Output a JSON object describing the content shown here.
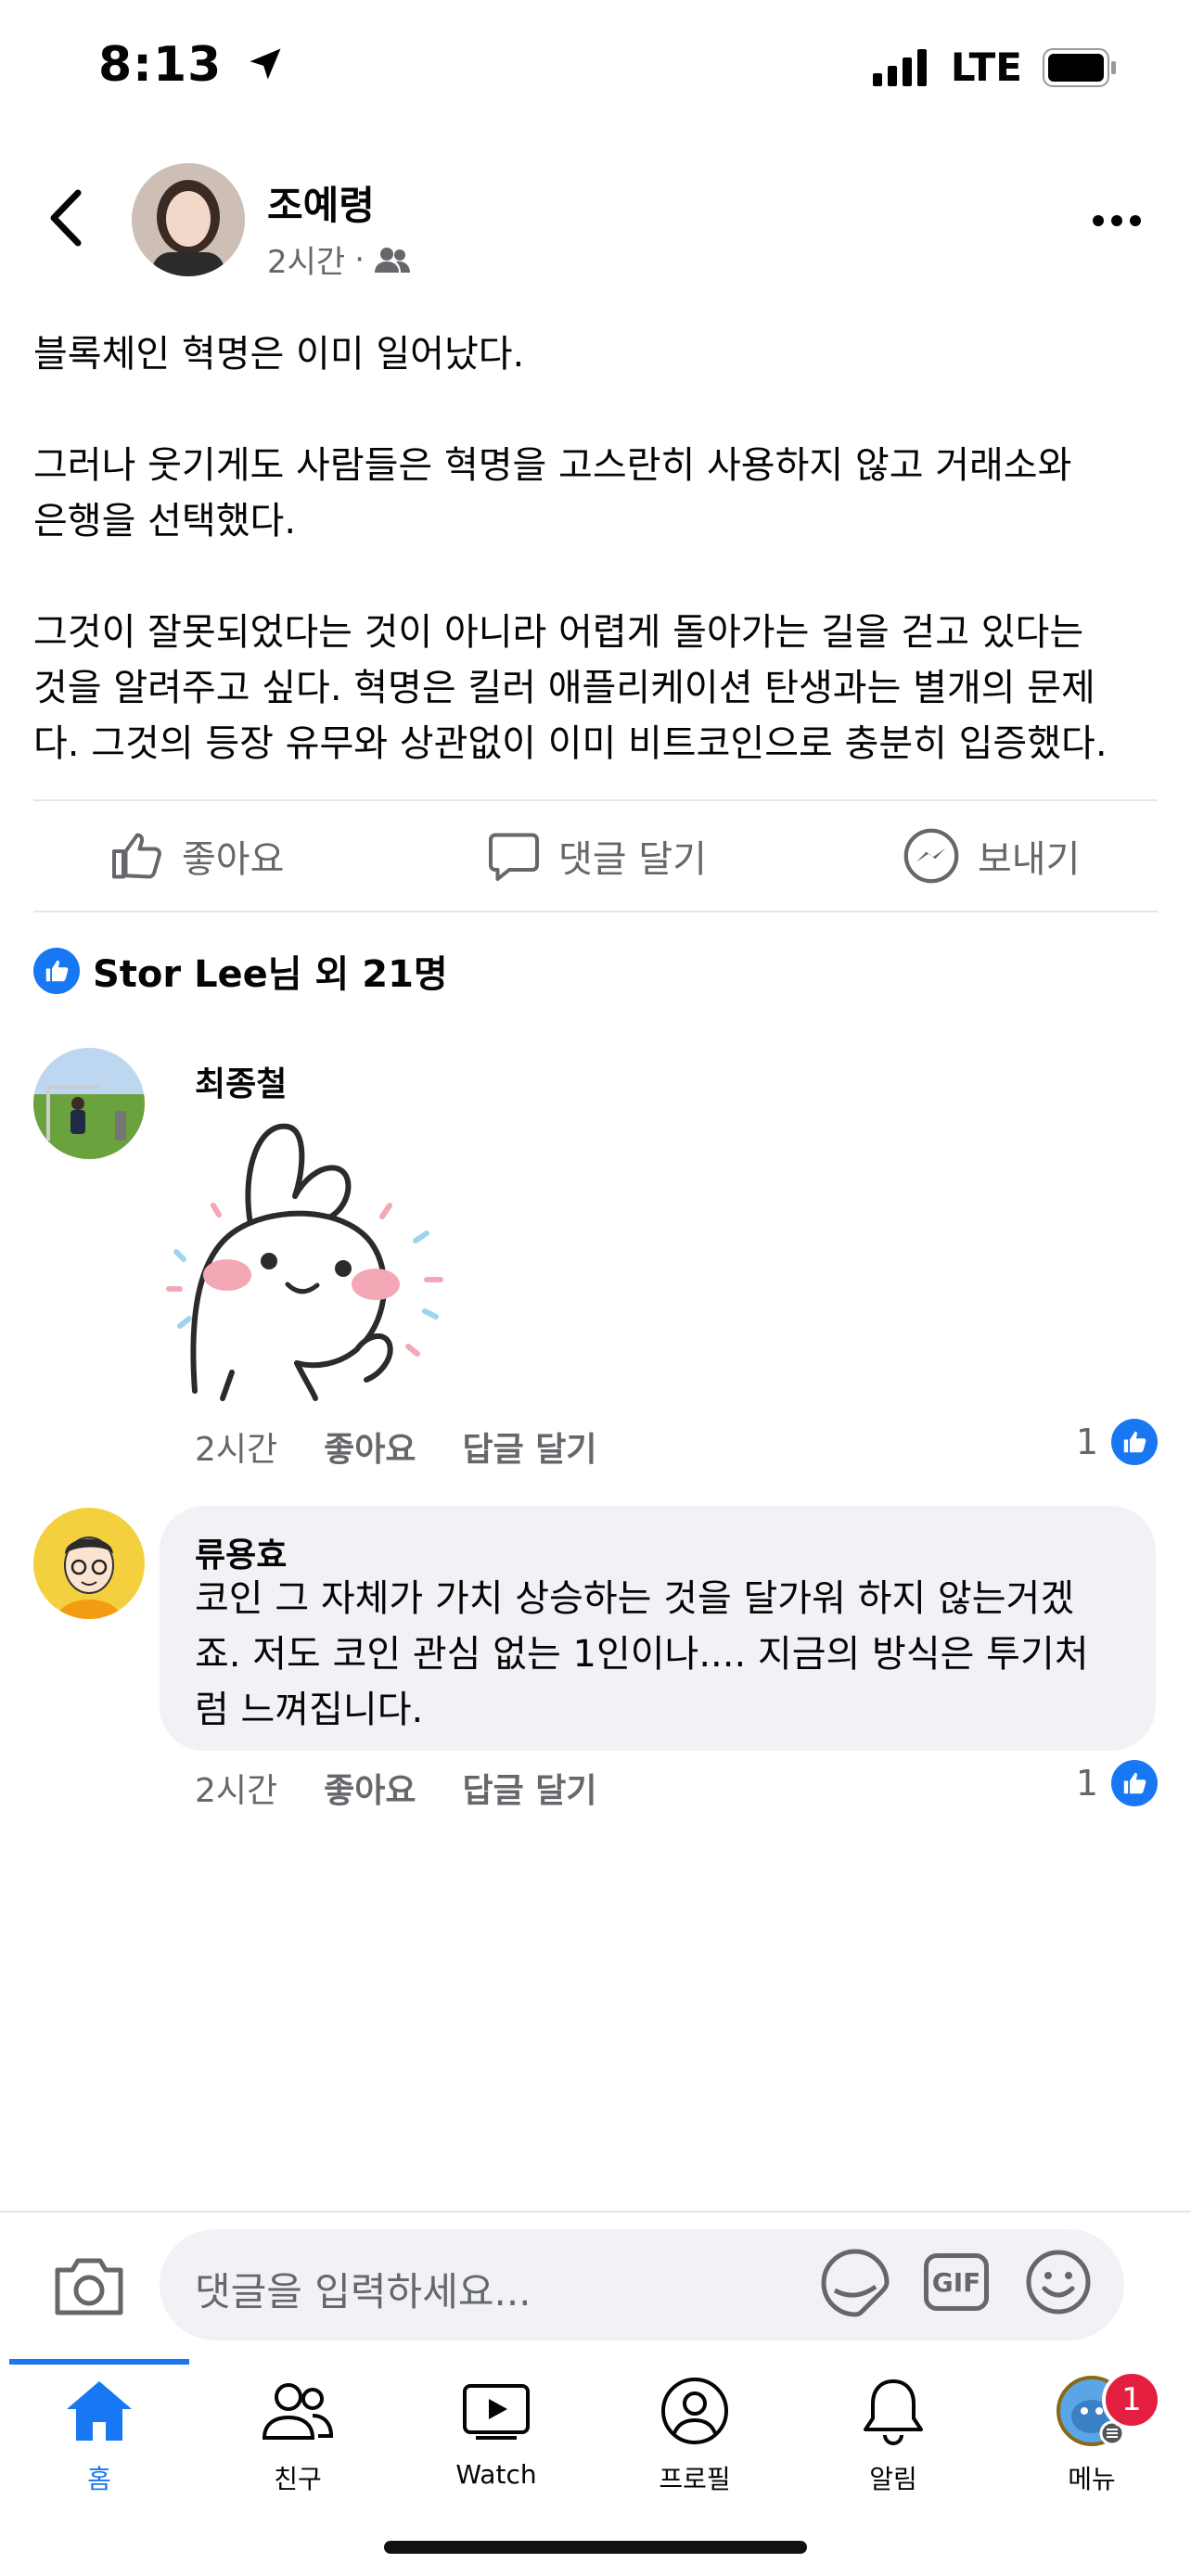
{
  "status_bar": {
    "time": "8:13",
    "network": "LTE"
  },
  "post": {
    "author": "조예령",
    "time": "2시간",
    "separator": "·",
    "lines": [
      "블록체인 혁명은 이미 일어났다.",
      "",
      "그러나 웃기게도 사람들은 혁명을 고스란히 사용하지 않고 거래소와",
      "은행을 선택했다.",
      "",
      "그것이 잘못되었다는 것이 아니라 어렵게 돌아가는 길을 걷고 있다는",
      "것을 알려주고 싶다. 혁명은 킬러 애플리케이션 탄생과는 별개의 문제",
      "다. 그것의 등장 유무와 상관없이 이미 비트코인으로 충분히 입증했다."
    ]
  },
  "actions": {
    "like": "좋아요",
    "comment": "댓글 달기",
    "send": "보내기"
  },
  "reactions": {
    "summary": "Stor Lee님 외 21명"
  },
  "comments": [
    {
      "name": "최종철",
      "time": "2시간",
      "like_label": "좋아요",
      "reply_label": "답글 달기",
      "like_count": "1"
    },
    {
      "name": "류용효",
      "text_lines": [
        "코인 그 자체가 가치 상승하는 것을 달가워 하지 않는거겠",
        "죠. 저도 코인 관심 없는 1인이나.... 지금의 방식은 투기처",
        "럼 느껴집니다."
      ],
      "time": "2시간",
      "like_label": "좋아요",
      "reply_label": "답글 달기",
      "like_count": "1"
    }
  ],
  "composer": {
    "placeholder": "댓글을 입력하세요...",
    "gif": "GIF"
  },
  "tabs": [
    {
      "label": "홈",
      "icon": "home-icon"
    },
    {
      "label": "친구",
      "icon": "friends-icon"
    },
    {
      "label": "Watch",
      "icon": "watch-icon"
    },
    {
      "label": "프로필",
      "icon": "profile-icon"
    },
    {
      "label": "알림",
      "icon": "bell-icon"
    },
    {
      "label": "메뉴",
      "icon": "menu-avatar-icon"
    }
  ],
  "menu_badge": "1",
  "colors": {
    "accent": "#1877f2",
    "badge": "#e41e3f",
    "muted": "#65676b"
  }
}
